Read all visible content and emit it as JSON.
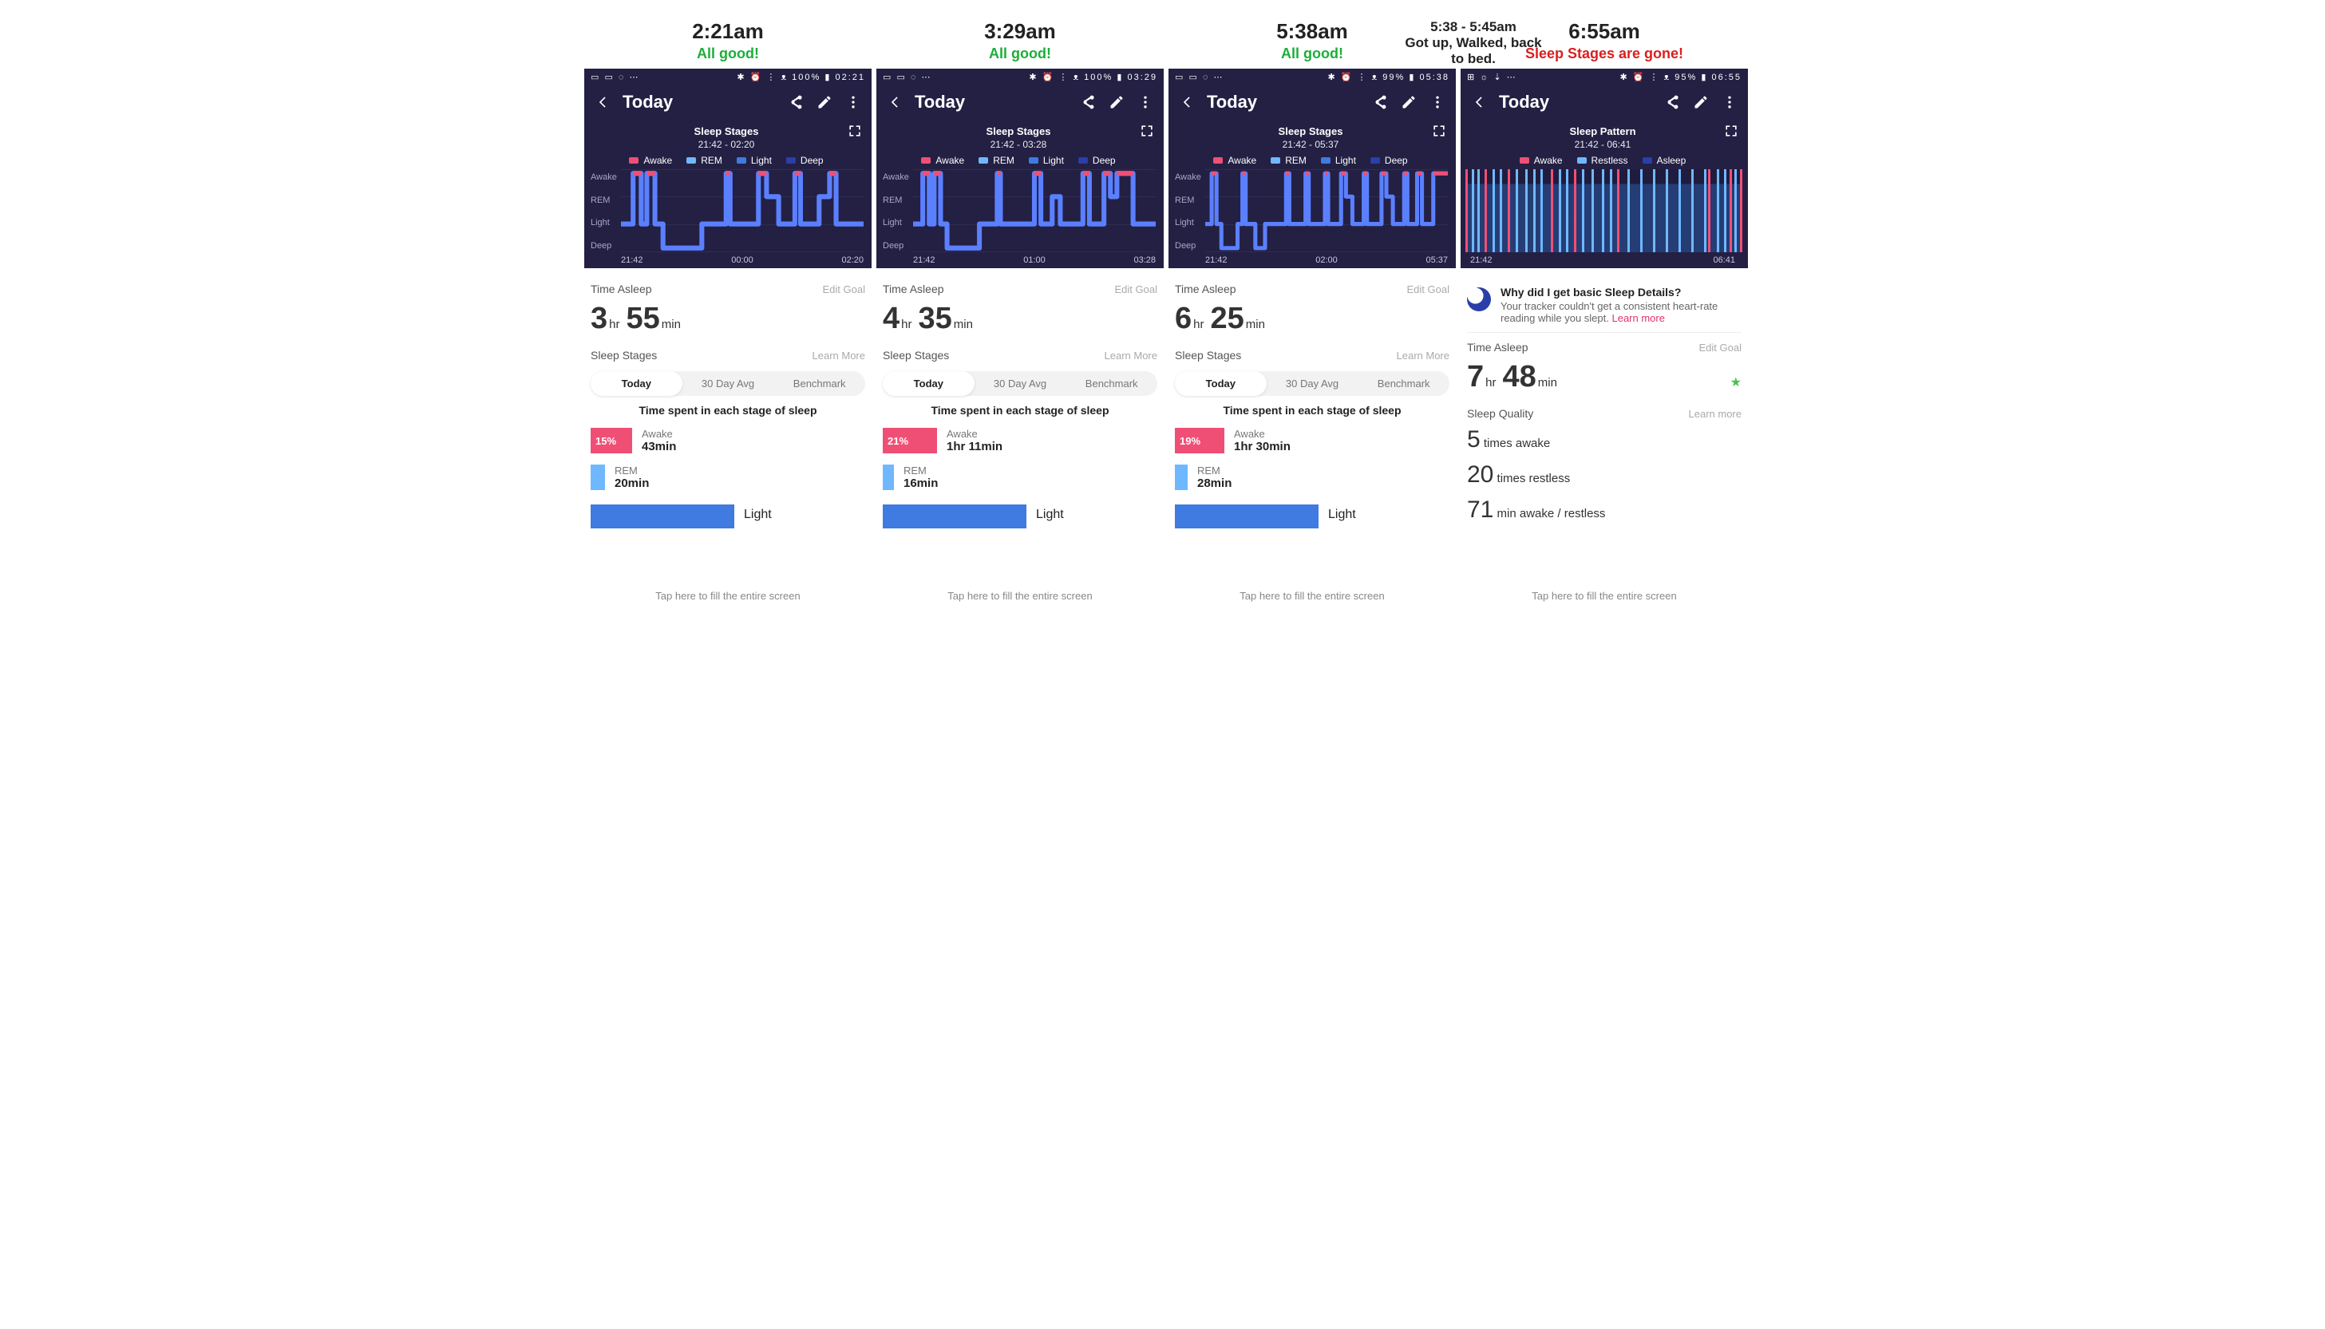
{
  "topcallout": {
    "line1": "5:38 - 5:45am",
    "line2": "Got up, Walked, back to bed."
  },
  "headers": [
    {
      "time": "2:21am",
      "sub": "All good!",
      "subclass": "green"
    },
    {
      "time": "3:29am",
      "sub": "All good!",
      "subclass": "green"
    },
    {
      "time": "5:38am",
      "sub": "All good!",
      "subclass": "green"
    },
    {
      "time": "6:55am",
      "sub": "Sleep Stages are gone!",
      "subclass": "red"
    }
  ],
  "common": {
    "today": "Today",
    "edit_goal": "Edit Goal",
    "learn_more": "Learn More",
    "learn_more_lc": "Learn more",
    "time_asleep": "Time Asleep",
    "sleep_stages": "Sleep Stages",
    "sleep_quality": "Sleep Quality",
    "seg": [
      "Today",
      "30 Day Avg",
      "Benchmark"
    ],
    "caption": "Time spent in each stage of sleep",
    "tap_hint": "Tap here to fill the entire screen",
    "stage_labels": [
      "Awake",
      "REM",
      "Light",
      "Deep"
    ],
    "pattern_labels": [
      "Awake",
      "Restless",
      "Asleep"
    ]
  },
  "screens": [
    {
      "status_left": "▭ ▭ ◌ ⋯",
      "status_right": "✱ ⏰ ⋮ ᴥ 100% ▮ 02:21",
      "chart_title": "Sleep Stages",
      "chart_sub": "21:42 - 02:20",
      "xticks": [
        "21:42",
        "00:00",
        "02:20"
      ],
      "asleep": {
        "h": "3",
        "m": "55"
      },
      "awake": {
        "pct": "15%",
        "dur": "43min"
      },
      "rem": {
        "dur": "20min"
      },
      "light_label": "Light"
    },
    {
      "status_left": "▭ ▭ ◌ ⋯",
      "status_right": "✱ ⏰ ⋮ ᴥ 100% ▮ 03:29",
      "chart_title": "Sleep Stages",
      "chart_sub": "21:42 - 03:28",
      "xticks": [
        "21:42",
        "01:00",
        "03:28"
      ],
      "asleep": {
        "h": "4",
        "m": "35"
      },
      "awake": {
        "pct": "21%",
        "dur": "1hr 11min"
      },
      "rem": {
        "dur": "16min"
      },
      "light_label": "Light"
    },
    {
      "status_left": "▭ ▭ ◌ ⋯",
      "status_right": "✱ ⏰ ⋮ ᴥ 99% ▮ 05:38",
      "chart_title": "Sleep Stages",
      "chart_sub": "21:42 - 05:37",
      "xticks": [
        "21:42",
        "02:00",
        "05:37"
      ],
      "asleep": {
        "h": "6",
        "m": "25"
      },
      "awake": {
        "pct": "19%",
        "dur": "1hr 30min"
      },
      "rem": {
        "dur": "28min"
      },
      "light_label": "Light"
    },
    {
      "status_left": "⊞ ☼ ⇣ ⋯",
      "status_right": "✱ ⏰ ⋮ ᴥ 95% ▮ 06:55",
      "chart_title": "Sleep Pattern",
      "chart_sub": "21:42 - 06:41",
      "xticks": [
        "21:42",
        "06:41"
      ],
      "asleep": {
        "h": "7",
        "m": "48"
      },
      "info_title": "Why did I get basic Sleep Details?",
      "info_body": "Your tracker couldn't get a consistent heart-rate reading while you slept. ",
      "quality": [
        {
          "n": "5",
          "t": " times awake"
        },
        {
          "n": "20",
          "t": " times restless"
        },
        {
          "n": "71",
          "t": " min awake / restless"
        }
      ]
    }
  ],
  "chart_data": [
    {
      "type": "step-area",
      "ylevels": [
        "Awake",
        "REM",
        "Light",
        "Deep"
      ],
      "xrange": [
        "21:42",
        "02:20"
      ],
      "segments_note": "approximate stage sequence read from chart",
      "segments": [
        [
          "21:42",
          "Light"
        ],
        [
          "22:00",
          "Awake"
        ],
        [
          "22:08",
          "Light"
        ],
        [
          "22:15",
          "Awake"
        ],
        [
          "22:22",
          "Light"
        ],
        [
          "22:30",
          "Deep"
        ],
        [
          "23:10",
          "Light"
        ],
        [
          "23:40",
          "Awake"
        ],
        [
          "23:44",
          "Light"
        ],
        [
          "00:20",
          "Awake"
        ],
        [
          "00:32",
          "REM"
        ],
        [
          "00:48",
          "Light"
        ],
        [
          "01:05",
          "Awake"
        ],
        [
          "01:10",
          "Light"
        ],
        [
          "01:30",
          "REM"
        ],
        [
          "01:45",
          "Awake"
        ],
        [
          "01:52",
          "Light"
        ],
        [
          "02:20",
          "Light"
        ]
      ]
    },
    {
      "type": "step-area",
      "ylevels": [
        "Awake",
        "REM",
        "Light",
        "Deep"
      ],
      "xrange": [
        "21:42",
        "03:28"
      ],
      "segments": [
        [
          "21:42",
          "Light"
        ],
        [
          "22:00",
          "Awake"
        ],
        [
          "22:08",
          "Light"
        ],
        [
          "22:15",
          "Awake"
        ],
        [
          "22:22",
          "Light"
        ],
        [
          "22:30",
          "Deep"
        ],
        [
          "23:10",
          "Light"
        ],
        [
          "23:40",
          "Awake"
        ],
        [
          "23:44",
          "Light"
        ],
        [
          "00:50",
          "Awake"
        ],
        [
          "01:00",
          "Light"
        ],
        [
          "01:20",
          "REM"
        ],
        [
          "01:30",
          "Light"
        ],
        [
          "02:10",
          "Awake"
        ],
        [
          "02:20",
          "Light"
        ],
        [
          "02:40",
          "Awake"
        ],
        [
          "02:48",
          "REM"
        ],
        [
          "02:55",
          "Awake"
        ],
        [
          "03:05",
          "Awake"
        ],
        [
          "03:12",
          "Light"
        ],
        [
          "03:28",
          "Light"
        ]
      ]
    },
    {
      "type": "step-area",
      "ylevels": [
        "Awake",
        "REM",
        "Light",
        "Deep"
      ],
      "xrange": [
        "21:42",
        "05:37"
      ],
      "segments": [
        [
          "21:42",
          "Light"
        ],
        [
          "21:55",
          "Awake"
        ],
        [
          "22:02",
          "Light"
        ],
        [
          "22:10",
          "Deep"
        ],
        [
          "22:45",
          "Light"
        ],
        [
          "22:55",
          "Awake"
        ],
        [
          "23:00",
          "Light"
        ],
        [
          "23:30",
          "Deep"
        ],
        [
          "23:50",
          "Light"
        ],
        [
          "00:40",
          "Awake"
        ],
        [
          "00:46",
          "Light"
        ],
        [
          "01:20",
          "Awake"
        ],
        [
          "01:26",
          "Light"
        ],
        [
          "01:55",
          "Awake"
        ],
        [
          "02:02",
          "Light"
        ],
        [
          "02:30",
          "Awake"
        ],
        [
          "02:36",
          "REM"
        ],
        [
          "02:50",
          "Light"
        ],
        [
          "03:20",
          "Awake"
        ],
        [
          "03:26",
          "Light"
        ],
        [
          "03:55",
          "Awake"
        ],
        [
          "04:02",
          "REM"
        ],
        [
          "04:18",
          "Light"
        ],
        [
          "04:40",
          "Awake"
        ],
        [
          "04:46",
          "Light"
        ],
        [
          "05:05",
          "Awake"
        ],
        [
          "05:12",
          "Light"
        ],
        [
          "05:37",
          "Awake"
        ]
      ]
    },
    {
      "type": "event-bars",
      "xrange": [
        "21:42",
        "06:41"
      ],
      "events_note": "approximate awake (pink) and restless (blue) marks, remainder = asleep",
      "awake_at": [
        "21:42",
        "22:20",
        "23:05",
        "00:30",
        "01:15",
        "02:40",
        "05:38",
        "06:20",
        "06:41"
      ],
      "restless_at": [
        "21:55",
        "22:05",
        "22:35",
        "22:50",
        "23:20",
        "23:40",
        "23:55",
        "00:10",
        "00:45",
        "01:00",
        "01:30",
        "01:50",
        "02:10",
        "02:25",
        "03:00",
        "03:25",
        "03:50",
        "04:15",
        "04:40",
        "05:05",
        "05:30",
        "05:55",
        "06:10",
        "06:30"
      ]
    }
  ]
}
